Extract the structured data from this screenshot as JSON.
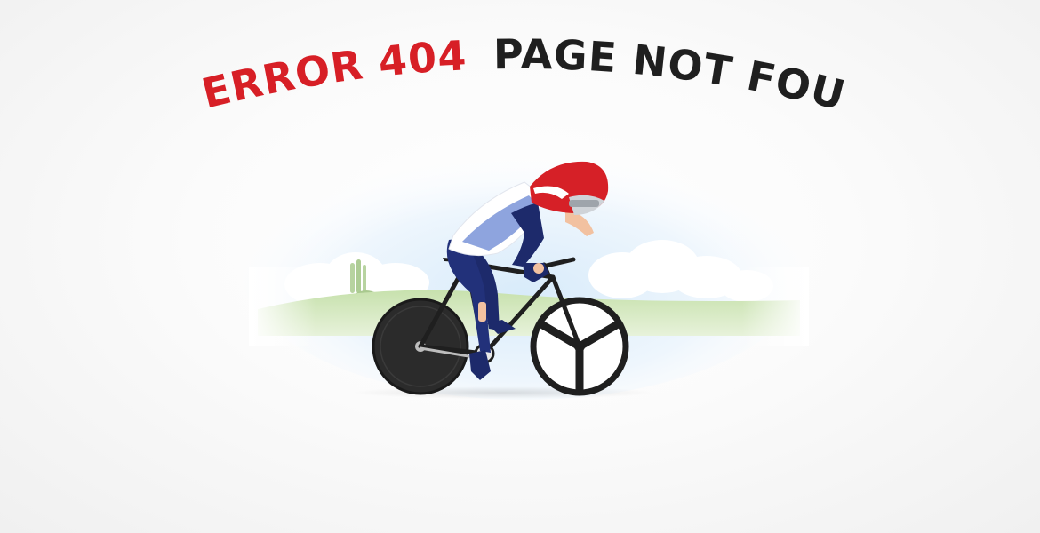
{
  "headline": {
    "error_label": "ERROR 404",
    "message_label": "PAGE NOT FOUND"
  },
  "colors": {
    "error_red": "#d71f26",
    "message_dark": "#1f1f1f",
    "jersey_blue": "#1d2a6b",
    "helmet_red": "#d62027",
    "grass_green": "#b9d99a",
    "sky_blue": "#dfeefa"
  },
  "illustration": {
    "subject": "cyclist-on-time-trial-bike",
    "icons": [
      "disc-wheel-icon",
      "tri-spoke-wheel-icon",
      "helmet-icon"
    ]
  }
}
